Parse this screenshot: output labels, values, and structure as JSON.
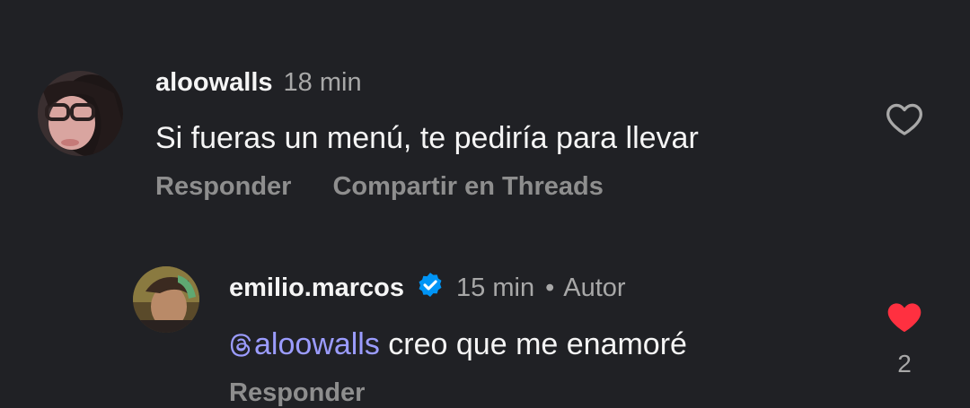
{
  "comments": [
    {
      "username": "aloowalls",
      "time": "18 min",
      "text": "Si fueras un menú, te pediría para llevar",
      "actions": {
        "reply": "Responder",
        "share": "Compartir en Threads"
      },
      "liked": false
    }
  ],
  "replies": [
    {
      "username": "emilio.marcos",
      "verified": true,
      "time": "15 min",
      "separator": "•",
      "author_label": "Autor",
      "mention": "aloowalls",
      "text": " creo que me enamoré",
      "actions": {
        "reply": "Responder"
      },
      "liked": true,
      "like_count": "2"
    }
  ],
  "colors": {
    "background": "#202125",
    "mention": "#9b9cff",
    "like_active": "#ff3040",
    "verified_badge": "#0095f6"
  }
}
